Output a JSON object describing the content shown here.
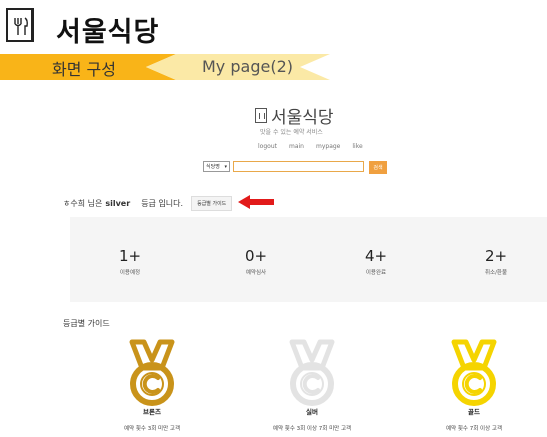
{
  "slide": {
    "title": "서울식당",
    "tabs": [
      {
        "label": "화면 구성",
        "active": true
      },
      {
        "label": "My page(2)",
        "active": false
      }
    ],
    "accent_colors": {
      "active_band": "#f9b418",
      "inactive_band": "#fbe9a6"
    }
  },
  "site": {
    "brand": "서울식당",
    "tagline": "맛을 수 있는 예약 서비스",
    "nav": [
      "logout",
      "main",
      "mypage",
      "like"
    ],
    "search": {
      "select_value": "식당명",
      "input_value": "",
      "button_label": "검색"
    }
  },
  "grade_info": {
    "prefix": "ㅎ수희 님은",
    "grade": "silver",
    "suffix": "등급 입니다.",
    "guide_button": "등급별 가이드"
  },
  "stats": [
    {
      "value": "1+",
      "label": "이용예정"
    },
    {
      "value": "0+",
      "label": "예약심사"
    },
    {
      "value": "4+",
      "label": "이용완료"
    },
    {
      "value": "2+",
      "label": "취소/환불"
    }
  ],
  "guide": {
    "title": "등급별 가이드",
    "medals": [
      {
        "name": "브론즈",
        "desc": "예약 횟수 3회 미만 고객",
        "color": "#c9931a",
        "icon": "bronze-medal-icon"
      },
      {
        "name": "실버",
        "desc": "예약 횟수 3회 이상 7회 미만 고객",
        "color": "#e3e3e3",
        "icon": "silver-medal-icon"
      },
      {
        "name": "골드",
        "desc": "예약 횟수 7회 이상 고객",
        "color": "#f5d400",
        "icon": "gold-medal-icon"
      }
    ]
  }
}
